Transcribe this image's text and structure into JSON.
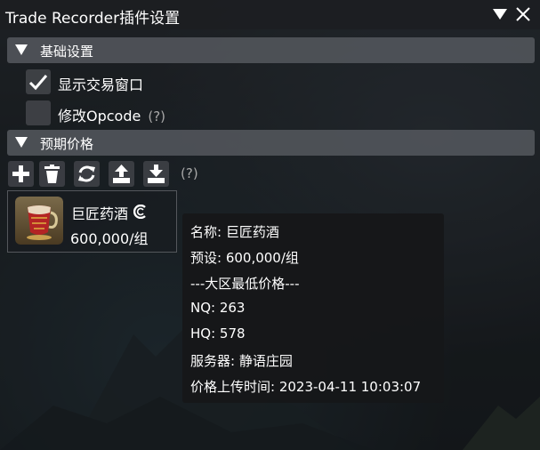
{
  "window": {
    "title": "Trade Recorder插件设置"
  },
  "sections": {
    "basic": {
      "label": "基础设置",
      "options": [
        {
          "label": "显示交易窗口",
          "checked": true
        },
        {
          "label": "修改Opcode",
          "checked": false,
          "hint": "(?)"
        }
      ]
    },
    "expected_price": {
      "label": "预期价格",
      "toolbar": {
        "buttons": [
          "plus-icon",
          "trash-icon",
          "refresh-icon",
          "upload-icon",
          "download-icon"
        ],
        "hint": "(?)"
      },
      "items": [
        {
          "name": "巨匠药酒",
          "price": "600,000/组",
          "quality_icon": "hq-icon"
        }
      ]
    }
  },
  "tooltip": {
    "lines": [
      "名称: 巨匠药酒",
      "预设: 600,000/组",
      "---大区最低价格---",
      "NQ: 263",
      "HQ: 578",
      "服务器: 静语庄园",
      "价格上传时间: 2023-04-11 10:03:07"
    ]
  }
}
